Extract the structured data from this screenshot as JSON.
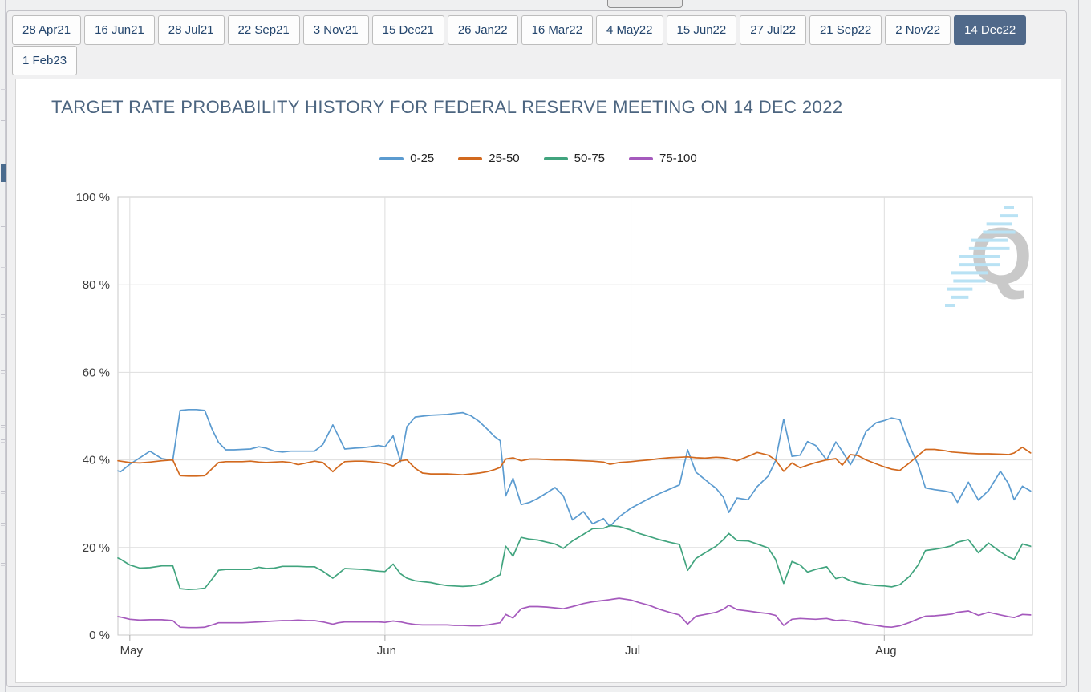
{
  "tabs": {
    "row1": [
      "28 Apr21",
      "16 Jun21",
      "28 Jul21",
      "22 Sep21",
      "3 Nov21",
      "15 Dec21",
      "26 Jan22",
      "16 Mar22",
      "4 May22",
      "15 Jun22",
      "27 Jul22",
      "21 Sep22",
      "2 Nov22",
      "14 Dec22"
    ],
    "row2": [
      "1 Feb23"
    ],
    "selected": "14 Dec22",
    "selected_bg": "#50698a"
  },
  "top_button": {
    "label": ""
  },
  "chart": {
    "title": "TARGET RATE PROBABILITY HISTORY FOR FEDERAL RESERVE MEETING ON 14 DEC 2022"
  },
  "chart_data": {
    "type": "line",
    "title": "TARGET RATE PROBABILITY HISTORY FOR FEDERAL RESERVE MEETING ON 14 DEC 2022",
    "ylabel": "",
    "xlabel": "",
    "ylim": [
      0,
      100
    ],
    "yticks": [
      0,
      20,
      40,
      60,
      80,
      100
    ],
    "ytick_suffix": " %",
    "grid": true,
    "legend_position": "top",
    "watermark": "Q",
    "x_months": [
      {
        "label": "May",
        "frac": 0.013
      },
      {
        "label": "Jun",
        "frac": 0.292
      },
      {
        "label": "Jul",
        "frac": 0.561
      },
      {
        "label": "Aug",
        "frac": 0.838
      }
    ],
    "x_frac": [
      0,
      0.003,
      0.013,
      0.024,
      0.035,
      0.048,
      0.06,
      0.068,
      0.077,
      0.086,
      0.095,
      0.103,
      0.11,
      0.118,
      0.127,
      0.136,
      0.145,
      0.154,
      0.162,
      0.171,
      0.18,
      0.189,
      0.197,
      0.206,
      0.215,
      0.224,
      0.235,
      0.241,
      0.248,
      0.259,
      0.268,
      0.276,
      0.285,
      0.292,
      0.301,
      0.309,
      0.316,
      0.325,
      0.333,
      0.342,
      0.351,
      0.36,
      0.368,
      0.377,
      0.386,
      0.395,
      0.404,
      0.412,
      0.418,
      0.424,
      0.432,
      0.441,
      0.45,
      0.459,
      0.469,
      0.478,
      0.487,
      0.497,
      0.509,
      0.519,
      0.531,
      0.538,
      0.548,
      0.561,
      0.57,
      0.581,
      0.592,
      0.603,
      0.614,
      0.623,
      0.632,
      0.642,
      0.654,
      0.662,
      0.668,
      0.677,
      0.689,
      0.699,
      0.711,
      0.719,
      0.728,
      0.737,
      0.746,
      0.754,
      0.763,
      0.775,
      0.785,
      0.792,
      0.801,
      0.809,
      0.818,
      0.829,
      0.838,
      0.846,
      0.855,
      0.866,
      0.875,
      0.883,
      0.893,
      0.904,
      0.912,
      0.918,
      0.93,
      0.941,
      0.952,
      0.965,
      0.974,
      0.98,
      0.989,
      0.998
    ],
    "series": [
      {
        "name": "0-25",
        "color": "#5b9bd0",
        "values": [
          37.5,
          37.3,
          39,
          40.5,
          42,
          40.3,
          39.9,
          51.3,
          51.5,
          51.5,
          51.3,
          47,
          44,
          42.3,
          42.3,
          42.4,
          42.5,
          43,
          42.7,
          42,
          41.8,
          42,
          42,
          42,
          42,
          43.5,
          48,
          45.5,
          42.5,
          42.7,
          42.8,
          43,
          43.3,
          43,
          45.5,
          39.6,
          47.6,
          49.8,
          50,
          50.2,
          50.3,
          50.4,
          50.6,
          50.8,
          50.1,
          48.8,
          47,
          45.3,
          44.4,
          31.8,
          35.8,
          29.8,
          30.3,
          31.2,
          32.5,
          33.7,
          31.8,
          26.3,
          28.2,
          25.4,
          26.6,
          24.8,
          27,
          29,
          30,
          31.2,
          32.3,
          33.3,
          34.3,
          42.3,
          37.2,
          35.5,
          33.5,
          31.5,
          28,
          31.3,
          30.9,
          33.9,
          36.3,
          39.8,
          49.3,
          40.8,
          41.1,
          44.2,
          43.3,
          40,
          44.1,
          42,
          38.9,
          42,
          46.5,
          48.5,
          49,
          49.6,
          49.2,
          43,
          38.9,
          33.6,
          33.2,
          32.9,
          32.5,
          30.3,
          34.9,
          30.8,
          33,
          37.4,
          34.5,
          30.9,
          34,
          32.9
        ]
      },
      {
        "name": "25-50",
        "color": "#d2691e",
        "values": [
          39.8,
          39.7,
          39.4,
          39.3,
          39.5,
          39.8,
          40,
          36.4,
          36.3,
          36.3,
          36.4,
          38,
          39.4,
          39.6,
          39.6,
          39.6,
          39.7,
          39.5,
          39.4,
          39.5,
          39.6,
          39.4,
          38.9,
          39.3,
          39.7,
          39.4,
          37.3,
          38.5,
          39.6,
          39.7,
          39.7,
          39.6,
          39.4,
          39.2,
          38.6,
          39.8,
          40,
          38.1,
          37,
          36.8,
          36.8,
          36.8,
          36.7,
          36.6,
          36.8,
          37,
          37.3,
          37.8,
          38.3,
          40.2,
          40.5,
          39.8,
          40.2,
          40.2,
          40.1,
          40,
          40,
          39.9,
          39.8,
          39.7,
          39.5,
          39,
          39.4,
          39.6,
          39.8,
          40,
          40.3,
          40.5,
          40.6,
          40.7,
          40.5,
          40.4,
          40.6,
          40.5,
          40.3,
          39.8,
          40.8,
          41.7,
          41.1,
          40,
          37.4,
          39.3,
          38.2,
          38.8,
          39.4,
          40,
          40.3,
          38.8,
          41.2,
          41,
          40,
          39.1,
          38.4,
          37.9,
          37.6,
          39.4,
          41,
          42.4,
          42.4,
          42.1,
          41.8,
          41.7,
          41.5,
          41.4,
          41.4,
          41.3,
          41.2,
          41.6,
          42.9,
          41.6
        ]
      },
      {
        "name": "50-75",
        "color": "#41a47e",
        "values": [
          17.6,
          17.3,
          16,
          15.3,
          15.4,
          15.8,
          15.8,
          10.6,
          10.4,
          10.5,
          10.7,
          12.8,
          14.8,
          15,
          15,
          15,
          15,
          15.5,
          15.2,
          15.3,
          15.7,
          15.7,
          15.7,
          15.6,
          15.6,
          14.6,
          13,
          14,
          15.2,
          15.1,
          15,
          14.8,
          14.6,
          14.5,
          16.2,
          14,
          13,
          12.4,
          12.2,
          12,
          11.6,
          11.3,
          11.2,
          11.1,
          11.2,
          11.5,
          12.2,
          13.2,
          13.8,
          20.3,
          18,
          22.3,
          21.9,
          21.7,
          21.2,
          20.8,
          19.8,
          21.5,
          23,
          24.3,
          24.4,
          25,
          24.8,
          24,
          23.2,
          22.5,
          21.8,
          21.2,
          20.7,
          14.8,
          17.5,
          18.8,
          20.3,
          21.8,
          23.2,
          21.6,
          21.5,
          20.8,
          19.9,
          17.3,
          11.8,
          16.8,
          16,
          14.4,
          15,
          15.6,
          12.9,
          13.3,
          12.4,
          11.9,
          11.6,
          11.3,
          11.2,
          11,
          11.5,
          13.5,
          16,
          19.3,
          19.6,
          20,
          20.4,
          21.2,
          21.8,
          18.8,
          21,
          19,
          17.8,
          17.3,
          20.8,
          20.3
        ]
      },
      {
        "name": "75-100",
        "color": "#a55abd",
        "values": [
          4.2,
          4.1,
          3.6,
          3.4,
          3.5,
          3.5,
          3.3,
          1.8,
          1.7,
          1.7,
          1.8,
          2.3,
          2.8,
          2.8,
          2.8,
          2.8,
          2.9,
          3,
          3.1,
          3.2,
          3.3,
          3.3,
          3.4,
          3.3,
          3.3,
          3,
          2.5,
          2.8,
          3,
          3,
          3,
          3,
          3,
          2.9,
          3.2,
          3,
          2.7,
          2.4,
          2.3,
          2.3,
          2.3,
          2.3,
          2.2,
          2.2,
          2.1,
          2.1,
          2.3,
          2.6,
          2.8,
          4.7,
          3.9,
          6,
          6.5,
          6.5,
          6.4,
          6.2,
          6,
          6.5,
          7.2,
          7.6,
          7.9,
          8.1,
          8.4,
          8,
          7.4,
          6.8,
          5.9,
          5.2,
          4.6,
          2.5,
          4.3,
          4.7,
          5.2,
          5.9,
          6.8,
          5.8,
          5.5,
          5.2,
          4.9,
          4.5,
          2.2,
          3.6,
          3.8,
          3.7,
          3.6,
          3.8,
          3.3,
          3.4,
          3.2,
          2.9,
          2.5,
          2.2,
          1.9,
          1.8,
          2.1,
          2.9,
          3.7,
          4.3,
          4.4,
          4.6,
          4.8,
          5.2,
          5.5,
          4.5,
          5.2,
          4.6,
          4.2,
          4,
          4.7,
          4.6
        ]
      }
    ]
  }
}
